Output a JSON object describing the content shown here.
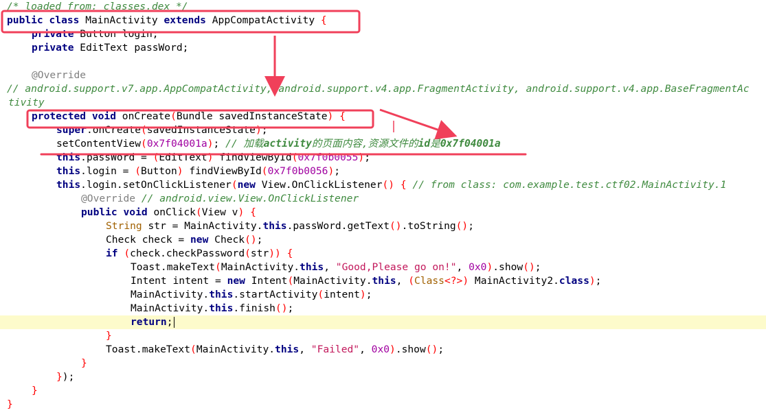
{
  "editor": {
    "current_line_index": 23,
    "lines": [
      {
        "indent": 0,
        "tokens": [
          {
            "t": "/* loaded from: classes.dex */",
            "c": "cm"
          }
        ]
      },
      {
        "indent": 0,
        "tokens": [
          {
            "t": "public class",
            "c": "kw"
          },
          {
            "t": " MainActivity ",
            "c": ""
          },
          {
            "t": "extends",
            "c": "kw"
          },
          {
            "t": " AppCompatActivity ",
            "c": ""
          },
          {
            "t": "{",
            "c": "br"
          }
        ]
      },
      {
        "indent": 1,
        "tokens": [
          {
            "t": "private",
            "c": "kw"
          },
          {
            "t": " Button login;",
            "c": ""
          }
        ]
      },
      {
        "indent": 1,
        "tokens": [
          {
            "t": "private",
            "c": "kw"
          },
          {
            "t": " EditText passWord;",
            "c": ""
          }
        ]
      },
      {
        "indent": 0,
        "tokens": []
      },
      {
        "indent": 1,
        "tokens": [
          {
            "t": "@Override",
            "c": "an"
          }
        ]
      },
      {
        "indent": 0,
        "tokens": [
          {
            "t": "// android.support.v7.app.AppCompatActivity, android.support.v4.app.FragmentActivity, android.support.v4.app.BaseFragmentAc",
            "c": "cm"
          }
        ]
      },
      {
        "indent": 0,
        "wrap": true,
        "tokens": [
          {
            "t": "tivity",
            "c": "cm"
          }
        ]
      },
      {
        "indent": 1,
        "tokens": [
          {
            "t": "protected void",
            "c": "kw"
          },
          {
            "t": " onCreate",
            "c": ""
          },
          {
            "t": "(",
            "c": "br"
          },
          {
            "t": "Bundle savedInstanceState",
            "c": ""
          },
          {
            "t": ")",
            "c": "br"
          },
          {
            "t": " ",
            "c": ""
          },
          {
            "t": "{",
            "c": "br"
          }
        ]
      },
      {
        "indent": 2,
        "tokens": [
          {
            "t": "super",
            "c": "kw"
          },
          {
            "t": ".onCreate",
            "c": ""
          },
          {
            "t": "(",
            "c": "br"
          },
          {
            "t": "savedInstanceState",
            "c": ""
          },
          {
            "t": ")",
            "c": "br"
          },
          {
            "t": ";",
            "c": ""
          }
        ]
      },
      {
        "indent": 2,
        "tokens": [
          {
            "t": "setContentView",
            "c": ""
          },
          {
            "t": "(",
            "c": "br"
          },
          {
            "t": "0x7f04001a",
            "c": "num"
          },
          {
            "t": ")",
            "c": "br"
          },
          {
            "t": "; ",
            "c": ""
          },
          {
            "t": "// 加载",
            "c": "cm"
          },
          {
            "t": "activity",
            "c": "cmb"
          },
          {
            "t": "的页面内容,资源文件的",
            "c": "cm"
          },
          {
            "t": "id",
            "c": "cmb"
          },
          {
            "t": "是",
            "c": "cm"
          },
          {
            "t": "0x7f04001a",
            "c": "cmb"
          }
        ]
      },
      {
        "indent": 2,
        "tokens": [
          {
            "t": "this",
            "c": "kw"
          },
          {
            "t": ".passWord = ",
            "c": ""
          },
          {
            "t": "(",
            "c": "br"
          },
          {
            "t": "EditText",
            "c": ""
          },
          {
            "t": ")",
            "c": "br"
          },
          {
            "t": " findViewById",
            "c": ""
          },
          {
            "t": "(",
            "c": "br"
          },
          {
            "t": "0x7f0b0055",
            "c": "num"
          },
          {
            "t": ")",
            "c": "br"
          },
          {
            "t": ";",
            "c": ""
          }
        ]
      },
      {
        "indent": 2,
        "tokens": [
          {
            "t": "this",
            "c": "kw"
          },
          {
            "t": ".login = ",
            "c": ""
          },
          {
            "t": "(",
            "c": "br"
          },
          {
            "t": "Button",
            "c": ""
          },
          {
            "t": ")",
            "c": "br"
          },
          {
            "t": " findViewById",
            "c": ""
          },
          {
            "t": "(",
            "c": "br"
          },
          {
            "t": "0x7f0b0056",
            "c": "num"
          },
          {
            "t": ")",
            "c": "br"
          },
          {
            "t": ";",
            "c": ""
          }
        ]
      },
      {
        "indent": 2,
        "tokens": [
          {
            "t": "this",
            "c": "kw"
          },
          {
            "t": ".login.setOnClickListener",
            "c": ""
          },
          {
            "t": "(",
            "c": "br"
          },
          {
            "t": "new",
            "c": "kw"
          },
          {
            "t": " View.OnClickListener",
            "c": ""
          },
          {
            "t": "()",
            "c": "br"
          },
          {
            "t": " ",
            "c": ""
          },
          {
            "t": "{",
            "c": "br"
          },
          {
            "t": " ",
            "c": ""
          },
          {
            "t": "// from class: com.example.test.ctf02.MainActivity.1",
            "c": "cm"
          }
        ]
      },
      {
        "indent": 3,
        "tokens": [
          {
            "t": "@Override",
            "c": "an"
          },
          {
            "t": " ",
            "c": ""
          },
          {
            "t": "// android.view.View.OnClickListener",
            "c": "cm"
          }
        ]
      },
      {
        "indent": 3,
        "tokens": [
          {
            "t": "public void",
            "c": "kw"
          },
          {
            "t": " onClick",
            "c": ""
          },
          {
            "t": "(",
            "c": "br"
          },
          {
            "t": "View v",
            "c": ""
          },
          {
            "t": ")",
            "c": "br"
          },
          {
            "t": " ",
            "c": ""
          },
          {
            "t": "{",
            "c": "br"
          }
        ]
      },
      {
        "indent": 4,
        "tokens": [
          {
            "t": "String",
            "c": "typ"
          },
          {
            "t": " str = MainActivity.",
            "c": ""
          },
          {
            "t": "this",
            "c": "kw"
          },
          {
            "t": ".passWord.getText",
            "c": ""
          },
          {
            "t": "()",
            "c": "br"
          },
          {
            "t": ".toString",
            "c": ""
          },
          {
            "t": "()",
            "c": "br"
          },
          {
            "t": ";",
            "c": ""
          }
        ]
      },
      {
        "indent": 4,
        "tokens": [
          {
            "t": "Check check = ",
            "c": ""
          },
          {
            "t": "new",
            "c": "kw"
          },
          {
            "t": " Check",
            "c": ""
          },
          {
            "t": "()",
            "c": "br"
          },
          {
            "t": ";",
            "c": ""
          }
        ]
      },
      {
        "indent": 4,
        "tokens": [
          {
            "t": "if",
            "c": "kw"
          },
          {
            "t": " ",
            "c": ""
          },
          {
            "t": "(",
            "c": "br"
          },
          {
            "t": "check.checkPassword",
            "c": ""
          },
          {
            "t": "(",
            "c": "br"
          },
          {
            "t": "str",
            "c": ""
          },
          {
            "t": "))",
            "c": "br"
          },
          {
            "t": " ",
            "c": ""
          },
          {
            "t": "{",
            "c": "br"
          }
        ]
      },
      {
        "indent": 5,
        "tokens": [
          {
            "t": "Toast.makeText",
            "c": ""
          },
          {
            "t": "(",
            "c": "br"
          },
          {
            "t": "MainActivity.",
            "c": ""
          },
          {
            "t": "this",
            "c": "kw"
          },
          {
            "t": ", ",
            "c": ""
          },
          {
            "t": "\"Good,Please go on!\"",
            "c": "str"
          },
          {
            "t": ", ",
            "c": ""
          },
          {
            "t": "0x0",
            "c": "num"
          },
          {
            "t": ")",
            "c": "br"
          },
          {
            "t": ".show",
            "c": ""
          },
          {
            "t": "()",
            "c": "br"
          },
          {
            "t": ";",
            "c": ""
          }
        ]
      },
      {
        "indent": 5,
        "tokens": [
          {
            "t": "Intent intent = ",
            "c": ""
          },
          {
            "t": "new",
            "c": "kw"
          },
          {
            "t": " Intent",
            "c": ""
          },
          {
            "t": "(",
            "c": "br"
          },
          {
            "t": "MainActivity.",
            "c": ""
          },
          {
            "t": "this",
            "c": "kw"
          },
          {
            "t": ", ",
            "c": ""
          },
          {
            "t": "(",
            "c": "br"
          },
          {
            "t": "Class",
            "c": "typ"
          },
          {
            "t": "<?>",
            "c": "br"
          },
          {
            "t": ")",
            "c": "br"
          },
          {
            "t": " MainActivity2.",
            "c": ""
          },
          {
            "t": "class",
            "c": "kw"
          },
          {
            "t": ")",
            "c": "br"
          },
          {
            "t": ";",
            "c": ""
          }
        ]
      },
      {
        "indent": 5,
        "tokens": [
          {
            "t": "MainActivity.",
            "c": ""
          },
          {
            "t": "this",
            "c": "kw"
          },
          {
            "t": ".startActivity",
            "c": ""
          },
          {
            "t": "(",
            "c": "br"
          },
          {
            "t": "intent",
            "c": ""
          },
          {
            "t": ")",
            "c": "br"
          },
          {
            "t": ";",
            "c": ""
          }
        ]
      },
      {
        "indent": 5,
        "tokens": [
          {
            "t": "MainActivity.",
            "c": ""
          },
          {
            "t": "this",
            "c": "kw"
          },
          {
            "t": ".finish",
            "c": ""
          },
          {
            "t": "()",
            "c": "br"
          },
          {
            "t": ";",
            "c": ""
          }
        ]
      },
      {
        "indent": 5,
        "cursor": true,
        "tokens": [
          {
            "t": "return",
            "c": "kw"
          },
          {
            "t": ";",
            "c": ""
          }
        ]
      },
      {
        "indent": 4,
        "tokens": [
          {
            "t": "}",
            "c": "br"
          }
        ]
      },
      {
        "indent": 4,
        "tokens": [
          {
            "t": "Toast.makeText",
            "c": ""
          },
          {
            "t": "(",
            "c": "br"
          },
          {
            "t": "MainActivity.",
            "c": ""
          },
          {
            "t": "this",
            "c": "kw"
          },
          {
            "t": ", ",
            "c": ""
          },
          {
            "t": "\"Failed\"",
            "c": "str"
          },
          {
            "t": ", ",
            "c": ""
          },
          {
            "t": "0x0",
            "c": "num"
          },
          {
            "t": ")",
            "c": "br"
          },
          {
            "t": ".show",
            "c": ""
          },
          {
            "t": "()",
            "c": "br"
          },
          {
            "t": ";",
            "c": ""
          }
        ]
      },
      {
        "indent": 3,
        "tokens": [
          {
            "t": "}",
            "c": "br"
          }
        ]
      },
      {
        "indent": 2,
        "tokens": [
          {
            "t": "}",
            "c": "br"
          },
          {
            "t": ");",
            "c": ""
          }
        ]
      },
      {
        "indent": 1,
        "tokens": [
          {
            "t": "}",
            "c": "br"
          }
        ]
      },
      {
        "indent": 0,
        "tokens": [
          {
            "t": "}",
            "c": "br"
          }
        ]
      }
    ]
  },
  "annotations": {
    "stroke_color": "#f0405a"
  }
}
